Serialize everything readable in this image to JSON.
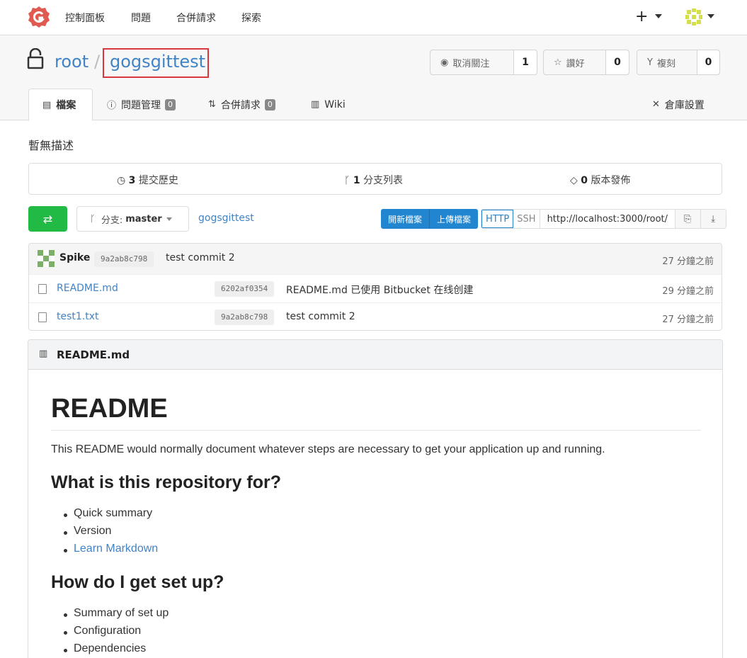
{
  "nav": {
    "links": [
      "控制面板",
      "問題",
      "合併請求",
      "探索"
    ],
    "plus": "+"
  },
  "repo": {
    "owner": "root",
    "separator": "/",
    "name": "gogsgittest",
    "watch": {
      "label": "取消關注",
      "count": "1"
    },
    "star": {
      "label": "讚好",
      "count": "0"
    },
    "fork": {
      "label": "複刻",
      "count": "0"
    }
  },
  "tabs": [
    {
      "label": "檔案",
      "icon": "file-icon"
    },
    {
      "label": "問題管理",
      "badge": "0",
      "icon": "issue-icon"
    },
    {
      "label": "合併請求",
      "badge": "0",
      "icon": "pull-request-icon"
    },
    {
      "label": "Wiki",
      "icon": "book-icon"
    },
    {
      "label": "倉庫設置",
      "icon": "tools-icon"
    }
  ],
  "description": "暫無描述",
  "stats": {
    "commits": {
      "count": "3",
      "label": "提交歷史"
    },
    "branches": {
      "count": "1",
      "label": "分支列表"
    },
    "releases": {
      "count": "0",
      "label": "版本發佈"
    }
  },
  "actions": {
    "branch_prefix": "分支:",
    "branch": "master",
    "breadcrumb": "gogsgittest",
    "new_file": "開新檔案",
    "upload_file": "上傳檔案",
    "http": "HTTP",
    "ssh": "SSH",
    "clone_url": "http://localhost:3000/root/"
  },
  "latest_commit": {
    "author": "Spike",
    "sha": "9a2ab8c798",
    "message": "test commit 2",
    "age": "27 分鐘之前"
  },
  "files": [
    {
      "name": "README.md",
      "sha": "6202af0354",
      "message": "README.md 已使用 Bitbucket 在线创建",
      "age": "29 分鐘之前"
    },
    {
      "name": "test1.txt",
      "sha": "9a2ab8c798",
      "message": "test commit 2",
      "age": "27 分鐘之前"
    }
  ],
  "readme": {
    "filename": "README.md",
    "h1": "README",
    "intro": "This README would normally document whatever steps are necessary to get your application up and running.",
    "h2a": "What is this repository for?",
    "list_a": [
      "Quick summary",
      "Version",
      "Learn Markdown"
    ],
    "h2b": "How do I get set up?",
    "list_b": [
      "Summary of set up",
      "Configuration",
      "Dependencies"
    ]
  },
  "colors": {
    "accent": "#4183c4",
    "green": "#21ba45",
    "blue": "#2185d0",
    "logo": "#e05a4f",
    "highlight_border": "#d9363e"
  }
}
